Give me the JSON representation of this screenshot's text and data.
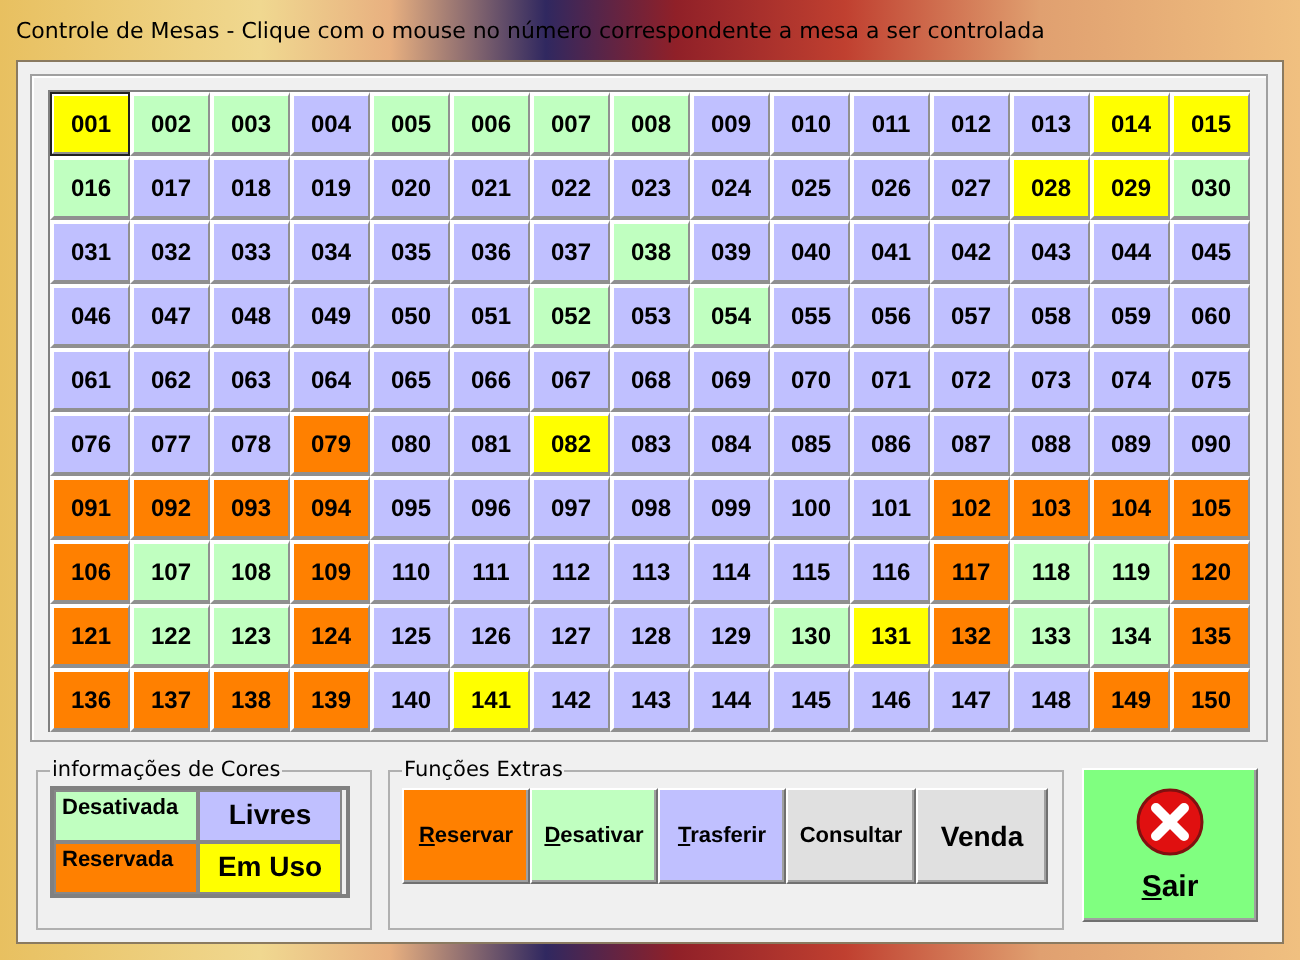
{
  "window": {
    "title": "Controle de Mesas  - Clique com o mouse no número correspondente a mesa a ser controlada"
  },
  "tables": [
    {
      "number": "001",
      "kind": "em_uso",
      "selected": true
    },
    {
      "number": "002",
      "kind": "desativada",
      "selected": false
    },
    {
      "number": "003",
      "kind": "desativada",
      "selected": false
    },
    {
      "number": "004",
      "kind": "livre",
      "selected": false
    },
    {
      "number": "005",
      "kind": "desativada",
      "selected": false
    },
    {
      "number": "006",
      "kind": "desativada",
      "selected": false
    },
    {
      "number": "007",
      "kind": "desativada",
      "selected": false
    },
    {
      "number": "008",
      "kind": "desativada",
      "selected": false
    },
    {
      "number": "009",
      "kind": "livre",
      "selected": false
    },
    {
      "number": "010",
      "kind": "livre",
      "selected": false
    },
    {
      "number": "011",
      "kind": "livre",
      "selected": false
    },
    {
      "number": "012",
      "kind": "livre",
      "selected": false
    },
    {
      "number": "013",
      "kind": "livre",
      "selected": false
    },
    {
      "number": "014",
      "kind": "em_uso",
      "selected": false
    },
    {
      "number": "015",
      "kind": "em_uso",
      "selected": false
    },
    {
      "number": "016",
      "kind": "desativada",
      "selected": false
    },
    {
      "number": "017",
      "kind": "livre",
      "selected": false
    },
    {
      "number": "018",
      "kind": "livre",
      "selected": false
    },
    {
      "number": "019",
      "kind": "livre",
      "selected": false
    },
    {
      "number": "020",
      "kind": "livre",
      "selected": false
    },
    {
      "number": "021",
      "kind": "livre",
      "selected": false
    },
    {
      "number": "022",
      "kind": "livre",
      "selected": false
    },
    {
      "number": "023",
      "kind": "livre",
      "selected": false
    },
    {
      "number": "024",
      "kind": "livre",
      "selected": false
    },
    {
      "number": "025",
      "kind": "livre",
      "selected": false
    },
    {
      "number": "026",
      "kind": "livre",
      "selected": false
    },
    {
      "number": "027",
      "kind": "livre",
      "selected": false
    },
    {
      "number": "028",
      "kind": "em_uso",
      "selected": false
    },
    {
      "number": "029",
      "kind": "em_uso",
      "selected": false
    },
    {
      "number": "030",
      "kind": "desativada",
      "selected": false
    },
    {
      "number": "031",
      "kind": "livre",
      "selected": false
    },
    {
      "number": "032",
      "kind": "livre",
      "selected": false
    },
    {
      "number": "033",
      "kind": "livre",
      "selected": false
    },
    {
      "number": "034",
      "kind": "livre",
      "selected": false
    },
    {
      "number": "035",
      "kind": "livre",
      "selected": false
    },
    {
      "number": "036",
      "kind": "livre",
      "selected": false
    },
    {
      "number": "037",
      "kind": "livre",
      "selected": false
    },
    {
      "number": "038",
      "kind": "desativada",
      "selected": false
    },
    {
      "number": "039",
      "kind": "livre",
      "selected": false
    },
    {
      "number": "040",
      "kind": "livre",
      "selected": false
    },
    {
      "number": "041",
      "kind": "livre",
      "selected": false
    },
    {
      "number": "042",
      "kind": "livre",
      "selected": false
    },
    {
      "number": "043",
      "kind": "livre",
      "selected": false
    },
    {
      "number": "044",
      "kind": "livre",
      "selected": false
    },
    {
      "number": "045",
      "kind": "livre",
      "selected": false
    },
    {
      "number": "046",
      "kind": "livre",
      "selected": false
    },
    {
      "number": "047",
      "kind": "livre",
      "selected": false
    },
    {
      "number": "048",
      "kind": "livre",
      "selected": false
    },
    {
      "number": "049",
      "kind": "livre",
      "selected": false
    },
    {
      "number": "050",
      "kind": "livre",
      "selected": false
    },
    {
      "number": "051",
      "kind": "livre",
      "selected": false
    },
    {
      "number": "052",
      "kind": "desativada",
      "selected": false
    },
    {
      "number": "053",
      "kind": "livre",
      "selected": false
    },
    {
      "number": "054",
      "kind": "desativada",
      "selected": false
    },
    {
      "number": "055",
      "kind": "livre",
      "selected": false
    },
    {
      "number": "056",
      "kind": "livre",
      "selected": false
    },
    {
      "number": "057",
      "kind": "livre",
      "selected": false
    },
    {
      "number": "058",
      "kind": "livre",
      "selected": false
    },
    {
      "number": "059",
      "kind": "livre",
      "selected": false
    },
    {
      "number": "060",
      "kind": "livre",
      "selected": false
    },
    {
      "number": "061",
      "kind": "livre",
      "selected": false
    },
    {
      "number": "062",
      "kind": "livre",
      "selected": false
    },
    {
      "number": "063",
      "kind": "livre",
      "selected": false
    },
    {
      "number": "064",
      "kind": "livre",
      "selected": false
    },
    {
      "number": "065",
      "kind": "livre",
      "selected": false
    },
    {
      "number": "066",
      "kind": "livre",
      "selected": false
    },
    {
      "number": "067",
      "kind": "livre",
      "selected": false
    },
    {
      "number": "068",
      "kind": "livre",
      "selected": false
    },
    {
      "number": "069",
      "kind": "livre",
      "selected": false
    },
    {
      "number": "070",
      "kind": "livre",
      "selected": false
    },
    {
      "number": "071",
      "kind": "livre",
      "selected": false
    },
    {
      "number": "072",
      "kind": "livre",
      "selected": false
    },
    {
      "number": "073",
      "kind": "livre",
      "selected": false
    },
    {
      "number": "074",
      "kind": "livre",
      "selected": false
    },
    {
      "number": "075",
      "kind": "livre",
      "selected": false
    },
    {
      "number": "076",
      "kind": "livre",
      "selected": false
    },
    {
      "number": "077",
      "kind": "livre",
      "selected": false
    },
    {
      "number": "078",
      "kind": "livre",
      "selected": false
    },
    {
      "number": "079",
      "kind": "reservada",
      "selected": false
    },
    {
      "number": "080",
      "kind": "livre",
      "selected": false
    },
    {
      "number": "081",
      "kind": "livre",
      "selected": false
    },
    {
      "number": "082",
      "kind": "em_uso",
      "selected": false
    },
    {
      "number": "083",
      "kind": "livre",
      "selected": false
    },
    {
      "number": "084",
      "kind": "livre",
      "selected": false
    },
    {
      "number": "085",
      "kind": "livre",
      "selected": false
    },
    {
      "number": "086",
      "kind": "livre",
      "selected": false
    },
    {
      "number": "087",
      "kind": "livre",
      "selected": false
    },
    {
      "number": "088",
      "kind": "livre",
      "selected": false
    },
    {
      "number": "089",
      "kind": "livre",
      "selected": false
    },
    {
      "number": "090",
      "kind": "livre",
      "selected": false
    },
    {
      "number": "091",
      "kind": "reservada",
      "selected": false
    },
    {
      "number": "092",
      "kind": "reservada",
      "selected": false
    },
    {
      "number": "093",
      "kind": "reservada",
      "selected": false
    },
    {
      "number": "094",
      "kind": "reservada",
      "selected": false
    },
    {
      "number": "095",
      "kind": "livre",
      "selected": false
    },
    {
      "number": "096",
      "kind": "livre",
      "selected": false
    },
    {
      "number": "097",
      "kind": "livre",
      "selected": false
    },
    {
      "number": "098",
      "kind": "livre",
      "selected": false
    },
    {
      "number": "099",
      "kind": "livre",
      "selected": false
    },
    {
      "number": "100",
      "kind": "livre",
      "selected": false
    },
    {
      "number": "101",
      "kind": "livre",
      "selected": false
    },
    {
      "number": "102",
      "kind": "reservada",
      "selected": false
    },
    {
      "number": "103",
      "kind": "reservada",
      "selected": false
    },
    {
      "number": "104",
      "kind": "reservada",
      "selected": false
    },
    {
      "number": "105",
      "kind": "reservada",
      "selected": false
    },
    {
      "number": "106",
      "kind": "reservada",
      "selected": false
    },
    {
      "number": "107",
      "kind": "desativada",
      "selected": false
    },
    {
      "number": "108",
      "kind": "desativada",
      "selected": false
    },
    {
      "number": "109",
      "kind": "reservada",
      "selected": false
    },
    {
      "number": "110",
      "kind": "livre",
      "selected": false
    },
    {
      "number": "111",
      "kind": "livre",
      "selected": false
    },
    {
      "number": "112",
      "kind": "livre",
      "selected": false
    },
    {
      "number": "113",
      "kind": "livre",
      "selected": false
    },
    {
      "number": "114",
      "kind": "livre",
      "selected": false
    },
    {
      "number": "115",
      "kind": "livre",
      "selected": false
    },
    {
      "number": "116",
      "kind": "livre",
      "selected": false
    },
    {
      "number": "117",
      "kind": "reservada",
      "selected": false
    },
    {
      "number": "118",
      "kind": "desativada",
      "selected": false
    },
    {
      "number": "119",
      "kind": "desativada",
      "selected": false
    },
    {
      "number": "120",
      "kind": "reservada",
      "selected": false
    },
    {
      "number": "121",
      "kind": "reservada",
      "selected": false
    },
    {
      "number": "122",
      "kind": "desativada",
      "selected": false
    },
    {
      "number": "123",
      "kind": "desativada",
      "selected": false
    },
    {
      "number": "124",
      "kind": "reservada",
      "selected": false
    },
    {
      "number": "125",
      "kind": "livre",
      "selected": false
    },
    {
      "number": "126",
      "kind": "livre",
      "selected": false
    },
    {
      "number": "127",
      "kind": "livre",
      "selected": false
    },
    {
      "number": "128",
      "kind": "livre",
      "selected": false
    },
    {
      "number": "129",
      "kind": "livre",
      "selected": false
    },
    {
      "number": "130",
      "kind": "desativada",
      "selected": false
    },
    {
      "number": "131",
      "kind": "em_uso",
      "selected": false
    },
    {
      "number": "132",
      "kind": "reservada",
      "selected": false
    },
    {
      "number": "133",
      "kind": "desativada",
      "selected": false
    },
    {
      "number": "134",
      "kind": "desativada",
      "selected": false
    },
    {
      "number": "135",
      "kind": "reservada",
      "selected": false
    },
    {
      "number": "136",
      "kind": "reservada",
      "selected": false
    },
    {
      "number": "137",
      "kind": "reservada",
      "selected": false
    },
    {
      "number": "138",
      "kind": "reservada",
      "selected": false
    },
    {
      "number": "139",
      "kind": "reservada",
      "selected": false
    },
    {
      "number": "140",
      "kind": "livre",
      "selected": false
    },
    {
      "number": "141",
      "kind": "em_uso",
      "selected": false
    },
    {
      "number": "142",
      "kind": "livre",
      "selected": false
    },
    {
      "number": "143",
      "kind": "livre",
      "selected": false
    },
    {
      "number": "144",
      "kind": "livre",
      "selected": false
    },
    {
      "number": "145",
      "kind": "livre",
      "selected": false
    },
    {
      "number": "146",
      "kind": "livre",
      "selected": false
    },
    {
      "number": "147",
      "kind": "livre",
      "selected": false
    },
    {
      "number": "148",
      "kind": "livre",
      "selected": false
    },
    {
      "number": "149",
      "kind": "reservada",
      "selected": false
    },
    {
      "number": "150",
      "kind": "reservada",
      "selected": false
    }
  ],
  "legend": {
    "title": "informações de Cores",
    "items": [
      {
        "label": "Desativada",
        "kind": "desativada"
      },
      {
        "label": "Livres",
        "kind": "livre"
      },
      {
        "label": "Reservada",
        "kind": "reservada"
      },
      {
        "label": "Em Uso",
        "kind": "em_uso"
      }
    ]
  },
  "functions": {
    "title": "Funções Extras",
    "buttons": [
      {
        "label": "Reservar",
        "color": "#ff8000",
        "mnemonic": true
      },
      {
        "label": "Desativar",
        "color": "#c0ffc0",
        "mnemonic": true
      },
      {
        "label": "Trasferir",
        "color": "#c0c0ff",
        "mnemonic": true
      },
      {
        "label": "Consultar",
        "color": "#e0e0e0",
        "mnemonic": false
      },
      {
        "label": "Venda",
        "color": "#e0e0e0",
        "mnemonic": false
      }
    ]
  },
  "exit_button": {
    "label": "Sair",
    "mnemonic": true
  }
}
